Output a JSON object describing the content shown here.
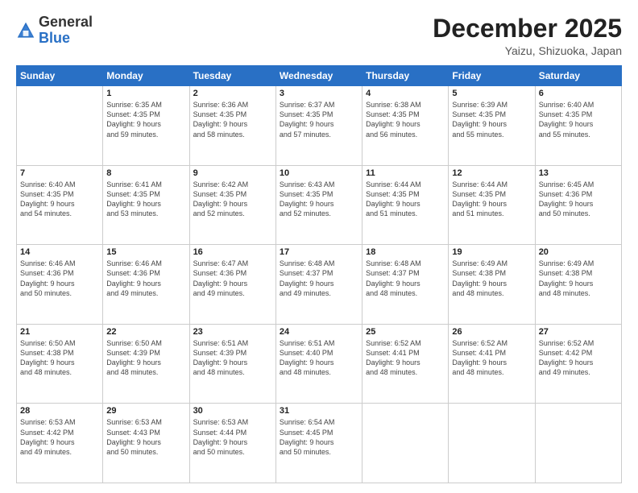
{
  "header": {
    "logo": {
      "general": "General",
      "blue": "Blue"
    },
    "title": "December 2025",
    "location": "Yaizu, Shizuoka, Japan"
  },
  "days_of_week": [
    "Sunday",
    "Monday",
    "Tuesday",
    "Wednesday",
    "Thursday",
    "Friday",
    "Saturday"
  ],
  "weeks": [
    [
      {
        "day": "",
        "info": ""
      },
      {
        "day": "1",
        "info": "Sunrise: 6:35 AM\nSunset: 4:35 PM\nDaylight: 9 hours\nand 59 minutes."
      },
      {
        "day": "2",
        "info": "Sunrise: 6:36 AM\nSunset: 4:35 PM\nDaylight: 9 hours\nand 58 minutes."
      },
      {
        "day": "3",
        "info": "Sunrise: 6:37 AM\nSunset: 4:35 PM\nDaylight: 9 hours\nand 57 minutes."
      },
      {
        "day": "4",
        "info": "Sunrise: 6:38 AM\nSunset: 4:35 PM\nDaylight: 9 hours\nand 56 minutes."
      },
      {
        "day": "5",
        "info": "Sunrise: 6:39 AM\nSunset: 4:35 PM\nDaylight: 9 hours\nand 55 minutes."
      },
      {
        "day": "6",
        "info": "Sunrise: 6:40 AM\nSunset: 4:35 PM\nDaylight: 9 hours\nand 55 minutes."
      }
    ],
    [
      {
        "day": "7",
        "info": "Sunrise: 6:40 AM\nSunset: 4:35 PM\nDaylight: 9 hours\nand 54 minutes."
      },
      {
        "day": "8",
        "info": "Sunrise: 6:41 AM\nSunset: 4:35 PM\nDaylight: 9 hours\nand 53 minutes."
      },
      {
        "day": "9",
        "info": "Sunrise: 6:42 AM\nSunset: 4:35 PM\nDaylight: 9 hours\nand 52 minutes."
      },
      {
        "day": "10",
        "info": "Sunrise: 6:43 AM\nSunset: 4:35 PM\nDaylight: 9 hours\nand 52 minutes."
      },
      {
        "day": "11",
        "info": "Sunrise: 6:44 AM\nSunset: 4:35 PM\nDaylight: 9 hours\nand 51 minutes."
      },
      {
        "day": "12",
        "info": "Sunrise: 6:44 AM\nSunset: 4:35 PM\nDaylight: 9 hours\nand 51 minutes."
      },
      {
        "day": "13",
        "info": "Sunrise: 6:45 AM\nSunset: 4:36 PM\nDaylight: 9 hours\nand 50 minutes."
      }
    ],
    [
      {
        "day": "14",
        "info": "Sunrise: 6:46 AM\nSunset: 4:36 PM\nDaylight: 9 hours\nand 50 minutes."
      },
      {
        "day": "15",
        "info": "Sunrise: 6:46 AM\nSunset: 4:36 PM\nDaylight: 9 hours\nand 49 minutes."
      },
      {
        "day": "16",
        "info": "Sunrise: 6:47 AM\nSunset: 4:36 PM\nDaylight: 9 hours\nand 49 minutes."
      },
      {
        "day": "17",
        "info": "Sunrise: 6:48 AM\nSunset: 4:37 PM\nDaylight: 9 hours\nand 49 minutes."
      },
      {
        "day": "18",
        "info": "Sunrise: 6:48 AM\nSunset: 4:37 PM\nDaylight: 9 hours\nand 48 minutes."
      },
      {
        "day": "19",
        "info": "Sunrise: 6:49 AM\nSunset: 4:38 PM\nDaylight: 9 hours\nand 48 minutes."
      },
      {
        "day": "20",
        "info": "Sunrise: 6:49 AM\nSunset: 4:38 PM\nDaylight: 9 hours\nand 48 minutes."
      }
    ],
    [
      {
        "day": "21",
        "info": "Sunrise: 6:50 AM\nSunset: 4:38 PM\nDaylight: 9 hours\nand 48 minutes."
      },
      {
        "day": "22",
        "info": "Sunrise: 6:50 AM\nSunset: 4:39 PM\nDaylight: 9 hours\nand 48 minutes."
      },
      {
        "day": "23",
        "info": "Sunrise: 6:51 AM\nSunset: 4:39 PM\nDaylight: 9 hours\nand 48 minutes."
      },
      {
        "day": "24",
        "info": "Sunrise: 6:51 AM\nSunset: 4:40 PM\nDaylight: 9 hours\nand 48 minutes."
      },
      {
        "day": "25",
        "info": "Sunrise: 6:52 AM\nSunset: 4:41 PM\nDaylight: 9 hours\nand 48 minutes."
      },
      {
        "day": "26",
        "info": "Sunrise: 6:52 AM\nSunset: 4:41 PM\nDaylight: 9 hours\nand 48 minutes."
      },
      {
        "day": "27",
        "info": "Sunrise: 6:52 AM\nSunset: 4:42 PM\nDaylight: 9 hours\nand 49 minutes."
      }
    ],
    [
      {
        "day": "28",
        "info": "Sunrise: 6:53 AM\nSunset: 4:42 PM\nDaylight: 9 hours\nand 49 minutes."
      },
      {
        "day": "29",
        "info": "Sunrise: 6:53 AM\nSunset: 4:43 PM\nDaylight: 9 hours\nand 50 minutes."
      },
      {
        "day": "30",
        "info": "Sunrise: 6:53 AM\nSunset: 4:44 PM\nDaylight: 9 hours\nand 50 minutes."
      },
      {
        "day": "31",
        "info": "Sunrise: 6:54 AM\nSunset: 4:45 PM\nDaylight: 9 hours\nand 50 minutes."
      },
      {
        "day": "",
        "info": ""
      },
      {
        "day": "",
        "info": ""
      },
      {
        "day": "",
        "info": ""
      }
    ]
  ]
}
